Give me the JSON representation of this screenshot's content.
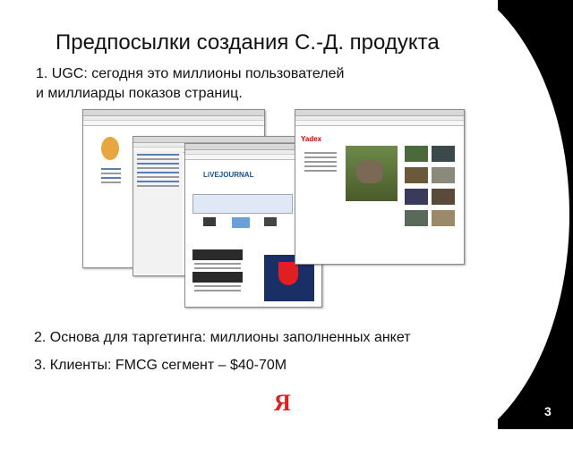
{
  "slide": {
    "title": "Предпосылки создания С.-Д. продукта",
    "point1_line1": "1. UGC: сегодня это миллионы пользователей",
    "point1_line2": "и миллиарды показов страниц.",
    "point2": "2. Основа для таргетинга: миллионы заполненных анкет",
    "point3": "3. Клиенты: FMCG сегмент – $40-70M",
    "page_number": "3",
    "logo_text": "Я"
  },
  "screenshots": {
    "lj_logo": "LiVEJOURNAL",
    "yandex_logo": "Yadex"
  },
  "colors": {
    "background": "#ffffff",
    "side_band": "#000000",
    "logo_red": "#e02020"
  }
}
